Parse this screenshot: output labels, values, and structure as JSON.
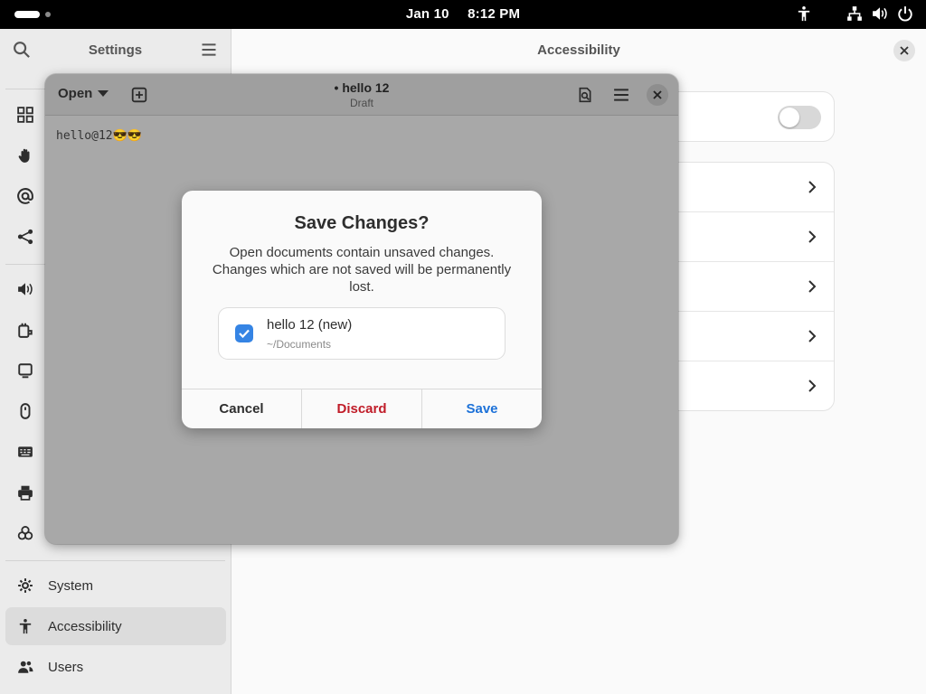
{
  "topbar": {
    "date": "Jan 10",
    "time": "8:12 PM",
    "icons": [
      "accessibility-icon",
      "network-icon",
      "volume-icon",
      "power-icon"
    ]
  },
  "settings": {
    "sidebar_title": "Settings",
    "items": [
      {
        "label": "System",
        "icon": "gear-icon"
      },
      {
        "label": "Accessibility",
        "icon": "accessibility-icon",
        "selected": true
      },
      {
        "label": "Users",
        "icon": "users-icon"
      }
    ],
    "content_title": "Accessibility"
  },
  "editor": {
    "open_label": "Open",
    "title": "• hello 12",
    "subtitle": "Draft",
    "text": "hello@12😎😎"
  },
  "dialog": {
    "title": "Save Changes?",
    "message": "Open documents contain unsaved changes. Changes which are not saved will be permanently lost.",
    "file_name": "hello 12 (new)",
    "file_path": "~/Documents",
    "checked": true,
    "cancel_label": "Cancel",
    "discard_label": "Discard",
    "save_label": "Save"
  },
  "colors": {
    "accent": "#3584e4",
    "destructive": "#c01c28",
    "save": "#1c71d8"
  }
}
